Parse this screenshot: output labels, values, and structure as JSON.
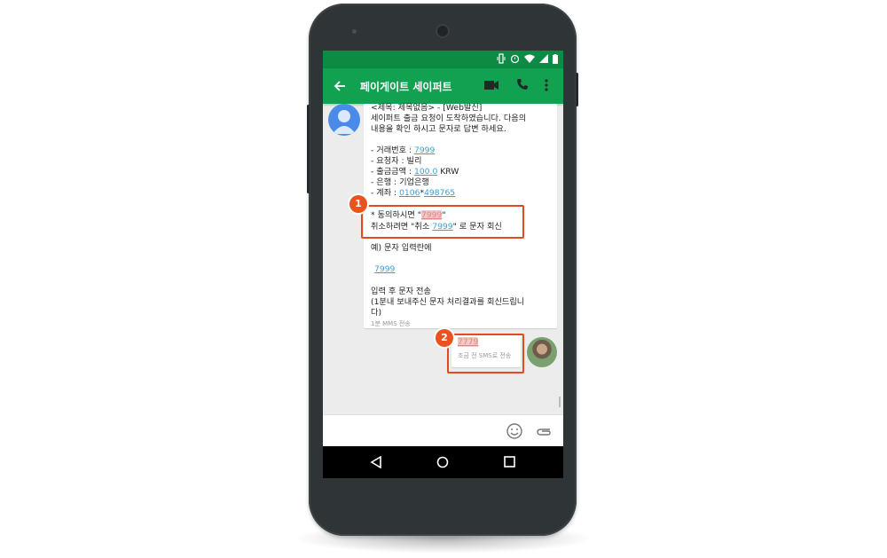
{
  "appbar": {
    "title": "페이게이트 세이퍼트"
  },
  "incoming": {
    "lines": [
      "<제목: 제목없음> - [Web발신]",
      "세이퍼트 출금 요청이 도착하였습니다. 다음의",
      "내용을 확인 하시고 문자로 답변 하세요."
    ],
    "details": {
      "tx_label": " - 거래번호 : ",
      "tx_value": "7999",
      "requester": " - 요청자 : 빌리",
      "amount_label": " - 출금금액 : ",
      "amount_value": "100.0",
      "amount_unit": " KRW",
      "bank": " - 은행 : 기업은행",
      "account_label": " - 계좌 : ",
      "account_a": "0106",
      "account_star": "*",
      "account_b": "498765"
    },
    "consent_prefix": "* 동의하시면 \"",
    "consent_code": "7999",
    "consent_suffix": "\"",
    "cancel_prefix": "  취소하려면 \"취소 ",
    "cancel_code": "7999",
    "cancel_suffix": "\" 로 문자 회신",
    "example": " 예) 문자 입력란에",
    "example_code": "7999",
    "instr1": "입력 후 문자 전송",
    "instr2": "(1분내 보내주신 문자 처리결과를 회신드립니",
    "instr3": "다)",
    "meta": "1분 MMS 전송"
  },
  "outgoing": {
    "text": "7779",
    "meta": "조금 전 SMS로 전송"
  },
  "annotations": {
    "badge1": "1",
    "badge2": "2"
  },
  "colors": {
    "statusbar": "#0d8a43",
    "appbar": "#12a150",
    "link": "#3aa0d8",
    "annotation": "#e24a1f"
  },
  "icons": [
    "back-arrow-icon",
    "video-call-icon",
    "phone-icon",
    "overflow-menu-icon",
    "emoji-icon",
    "attach-icon",
    "nav-back-icon",
    "nav-home-icon",
    "nav-recents-icon",
    "vibrate-icon",
    "alarm-icon",
    "wifi-icon",
    "signal-icon",
    "battery-icon"
  ]
}
